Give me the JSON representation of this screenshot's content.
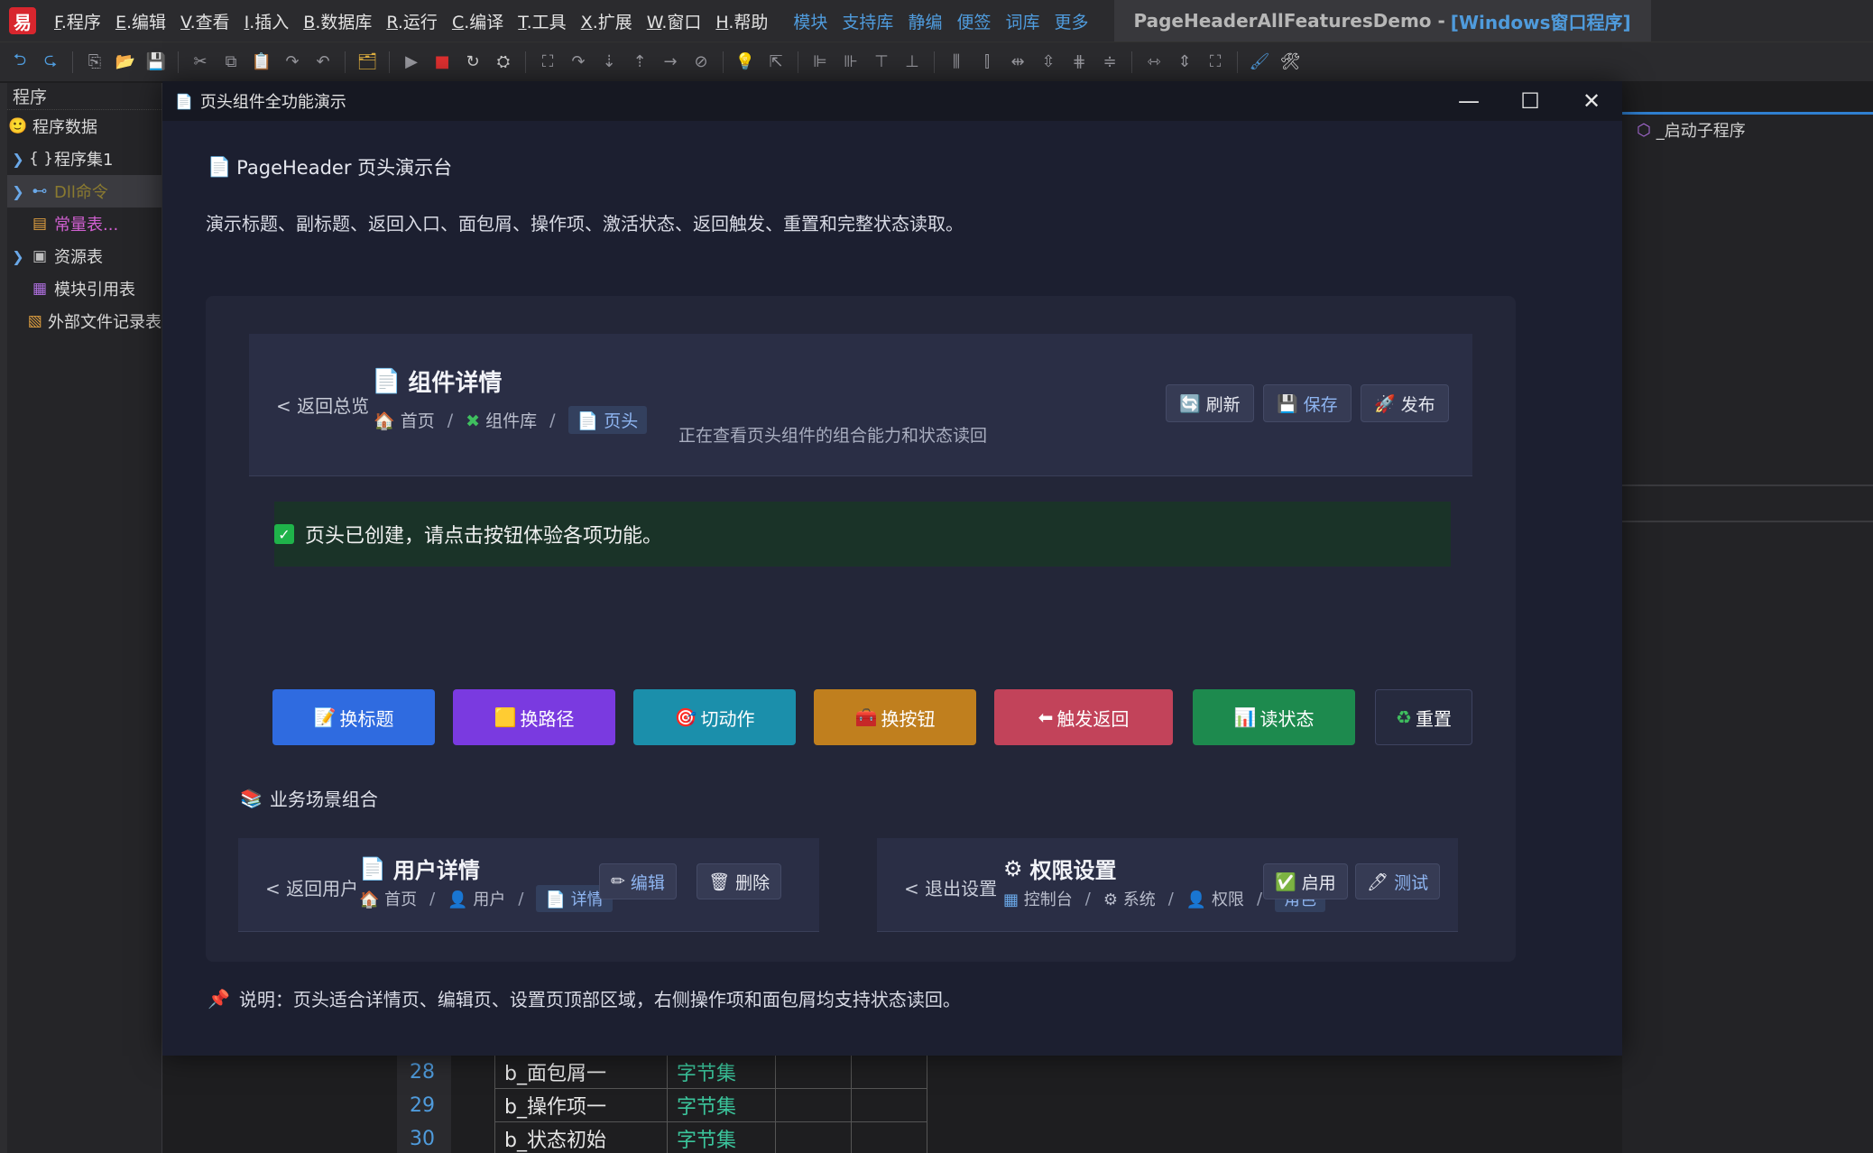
{
  "ide": {
    "logo": "易",
    "menus": [
      {
        "key": "F",
        "label": ".程序"
      },
      {
        "key": "E",
        "label": ".编辑"
      },
      {
        "key": "V",
        "label": ".查看"
      },
      {
        "key": "I",
        "label": ".插入"
      },
      {
        "key": "B",
        "label": ".数据库"
      },
      {
        "key": "R",
        "label": ".运行"
      },
      {
        "key": "C",
        "label": ".编译"
      },
      {
        "key": "T",
        "label": ".工具"
      },
      {
        "key": "X",
        "label": ".扩展"
      },
      {
        "key": "W",
        "label": ".窗口"
      },
      {
        "key": "H",
        "label": ".帮助"
      }
    ],
    "links": [
      "模块",
      "支持库",
      "静编",
      "便签",
      "词库",
      "更多"
    ],
    "title": "PageHeaderAllFeaturesDemo -",
    "project_type": "[Windows窗口程序]"
  },
  "tree": {
    "header": "程序",
    "items": [
      {
        "label": "程序数据",
        "icon": "🙂",
        "arrow": ""
      },
      {
        "label": "程序集1",
        "icon": "{ }",
        "arrow": "❯"
      },
      {
        "label": "Dll命令",
        "icon": "⊷",
        "arrow": "❯"
      },
      {
        "label": "常量表...",
        "icon": "▤",
        "arrow": ""
      },
      {
        "label": "资源表",
        "icon": "▣",
        "arrow": "❯"
      },
      {
        "label": "模块引用表",
        "icon": "▦",
        "arrow": ""
      },
      {
        "label": "外部文件记录表",
        "icon": "▧",
        "arrow": ""
      }
    ]
  },
  "right_panel": {
    "tab_label": "_启动子程序"
  },
  "code_rows": [
    {
      "line": "28",
      "name": "b_面包屑一",
      "type": "字节集"
    },
    {
      "line": "29",
      "name": "b_操作项一",
      "type": "字节集"
    },
    {
      "line": "30",
      "name": "b_状态初始",
      "type": "字节集"
    }
  ],
  "modal": {
    "title": "页头组件全功能演示",
    "minimize": "—",
    "maximize": "☐",
    "close": "✕",
    "demo_title": "PageHeader 页头演示台",
    "demo_desc": "演示标题、副标题、返回入口、面包屑、操作项、激活状态、返回触发、重置和完整状态读取。",
    "main_header": {
      "back": "< 返回总览",
      "title": "组件详情",
      "crumbs": [
        {
          "icon": "🏠",
          "label": "首页"
        },
        {
          "icon": "✖",
          "label": "组件库"
        },
        {
          "icon": "📄",
          "label": "页头"
        }
      ],
      "subtitle": "正在查看页头组件的组合能力和状态读回",
      "actions": [
        {
          "icon": "🔄",
          "label": "刷新"
        },
        {
          "icon": "💾",
          "label": "保存"
        },
        {
          "icon": "🚀",
          "label": "发布"
        }
      ]
    },
    "status_text": "页头已创建，请点击按钮体验各项功能。",
    "buttons": [
      {
        "icon": "📝",
        "label": "换标题",
        "color": "#2f6be0"
      },
      {
        "icon": "🟨",
        "label": "换路径",
        "color": "#7a3ae0"
      },
      {
        "icon": "🎯",
        "label": "切动作",
        "color": "#1b8fab"
      },
      {
        "icon": "🧰",
        "label": "换按钮",
        "color": "#c07f1e"
      },
      {
        "icon": "⬅",
        "label": "触发返回",
        "color": "#c2435a"
      },
      {
        "icon": "📊",
        "label": "读状态",
        "color": "#1d8a4e"
      },
      {
        "icon": "♻",
        "label": "重置",
        "color": "#262a3e"
      }
    ],
    "scenario_title": "业务场景组合",
    "user_header": {
      "back": "< 返回用户",
      "title": "用户详情",
      "crumbs": [
        {
          "icon": "🏠",
          "label": "首页"
        },
        {
          "icon": "👤",
          "label": "用户"
        },
        {
          "icon": "📄",
          "label": "详情"
        }
      ],
      "actions": [
        {
          "icon": "✏",
          "label": "编辑"
        },
        {
          "icon": "🗑",
          "label": "删除"
        }
      ]
    },
    "perm_header": {
      "back": "< 退出设置",
      "title": "权限设置",
      "crumbs": [
        {
          "icon": "▦",
          "label": "控制台"
        },
        {
          "icon": "⚙",
          "label": "系统"
        },
        {
          "icon": "👤",
          "label": "权限"
        },
        {
          "icon": "",
          "label": "角色"
        }
      ],
      "actions": [
        {
          "icon": "✅",
          "label": "启用"
        },
        {
          "icon": "🖊",
          "label": "测试"
        }
      ]
    },
    "note": "说明：页头适合详情页、编辑页、设置页顶部区域，右侧操作项和面包屑均支持状态读回。"
  }
}
